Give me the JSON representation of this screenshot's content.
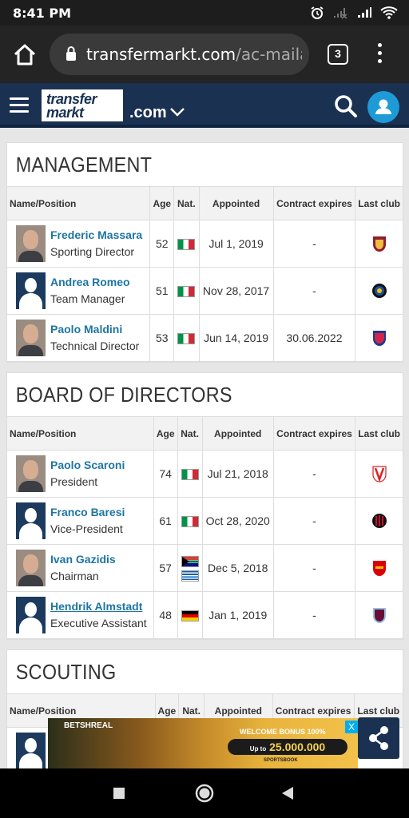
{
  "status_bar": {
    "time": "8:41 PM"
  },
  "browser": {
    "url_host": "transfermarkt.com",
    "url_path": "/ac-mailar",
    "tab_count": "3"
  },
  "site": {
    "logo_line1": "transfer",
    "logo_line2_a": "",
    "logo_line2_b": "markt",
    "domain_suffix": ".com"
  },
  "columns": {
    "name": "Name/Position",
    "age": "Age",
    "nat": "Nat.",
    "appointed": "Appointed",
    "contract": "Contract expires",
    "last_club": "Last club"
  },
  "sections": {
    "management": {
      "title": "MANAGEMENT",
      "rows": [
        {
          "name": "Frederic Massara",
          "position": "Sporting Director",
          "age": "52",
          "nat": [
            "it"
          ],
          "appointed": "Jul 1, 2019",
          "contract": "-",
          "club_icon": "as-roma-crest-icon"
        },
        {
          "name": "Andrea Romeo",
          "position": "Team Manager",
          "age": "51",
          "nat": [
            "it"
          ],
          "appointed": "Nov 28, 2017",
          "contract": "-",
          "club_icon": "inter-milan-crest-icon"
        },
        {
          "name": "Paolo Maldini",
          "position": "Technical Director",
          "age": "53",
          "nat": [
            "it"
          ],
          "appointed": "Jun 14, 2019",
          "contract": "30.06.2022",
          "club_icon": "miami-fc-crest-icon"
        }
      ]
    },
    "board": {
      "title": "BOARD OF DIRECTORS",
      "rows": [
        {
          "name": "Paolo Scaroni",
          "position": "President",
          "age": "74",
          "nat": [
            "it"
          ],
          "appointed": "Jul 21, 2018",
          "contract": "-",
          "club_icon": "vicenza-crest-icon"
        },
        {
          "name": "Franco Baresi",
          "position": "Vice-President",
          "age": "61",
          "nat": [
            "it"
          ],
          "appointed": "Oct 28, 2020",
          "contract": "-",
          "club_icon": "ac-milan-crest-icon"
        },
        {
          "name": "Ivan Gazidis",
          "position": "Chairman",
          "age": "57",
          "nat": [
            "za",
            "gr"
          ],
          "appointed": "Dec 5, 2018",
          "contract": "-",
          "club_icon": "arsenal-crest-icon"
        },
        {
          "name": "Hendrik Almstadt",
          "position": "Executive Assistant",
          "age": "48",
          "nat": [
            "de"
          ],
          "appointed": "Jan 1, 2019",
          "contract": "-",
          "club_icon": "aston-villa-crest-icon"
        }
      ]
    },
    "scouting": {
      "title": "SCOUTING"
    }
  },
  "ad": {
    "brand": "BETSHREAL",
    "bonus_label": "WELCOME BONUS 100%",
    "amount_prefix": "Up to",
    "amount": "25.000.000",
    "tagline": "SPORTSBOOK",
    "close": "X"
  },
  "colors": {
    "site_header": "#1a3151",
    "link": "#1d75a3",
    "user_button": "#1e9ad6"
  }
}
